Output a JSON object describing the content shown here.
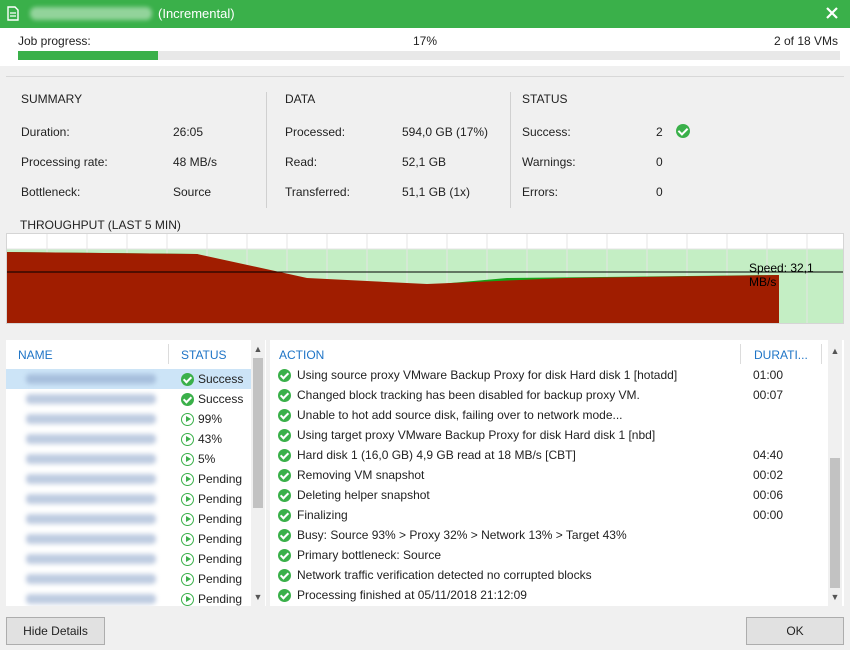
{
  "window": {
    "title": "(Incremental)",
    "close_label": "✕"
  },
  "progress": {
    "label": "Job progress:",
    "percent_text": "17%",
    "percent_value": 0.17,
    "vms_text": "2 of 18 VMs"
  },
  "summary": {
    "heading": "SUMMARY",
    "rows": [
      {
        "key": "Duration:",
        "value": "26:05"
      },
      {
        "key": "Processing rate:",
        "value": "48 MB/s"
      },
      {
        "key": "Bottleneck:",
        "value": "Source"
      }
    ]
  },
  "data": {
    "heading": "DATA",
    "rows": [
      {
        "key": "Processed:",
        "value": "594,0 GB (17%)"
      },
      {
        "key": "Read:",
        "value": "52,1 GB"
      },
      {
        "key": "Transferred:",
        "value": "51,1 GB (1x)"
      }
    ]
  },
  "status": {
    "heading": "STATUS",
    "rows": [
      {
        "key": "Success:",
        "value": "2"
      },
      {
        "key": "Warnings:",
        "value": "0"
      },
      {
        "key": "Errors:",
        "value": "0"
      }
    ]
  },
  "throughput": {
    "label": "THROUGHPUT (LAST 5 MIN)",
    "speed_label": "Speed: 32,1 MB/s"
  },
  "vm_list": {
    "name_header": "NAME",
    "status_header": "STATUS",
    "items": [
      {
        "status": "Success",
        "kind": "ok"
      },
      {
        "status": "Success",
        "kind": "ok"
      },
      {
        "status": "99%",
        "kind": "play"
      },
      {
        "status": "43%",
        "kind": "play"
      },
      {
        "status": "5%",
        "kind": "play"
      },
      {
        "status": "Pending",
        "kind": "play"
      },
      {
        "status": "Pending",
        "kind": "play"
      },
      {
        "status": "Pending",
        "kind": "play"
      },
      {
        "status": "Pending",
        "kind": "play"
      },
      {
        "status": "Pending",
        "kind": "play"
      },
      {
        "status": "Pending",
        "kind": "play"
      },
      {
        "status": "Pending",
        "kind": "play"
      }
    ]
  },
  "actions": {
    "action_header": "ACTION",
    "duration_header": "DURATI...",
    "items": [
      {
        "text": "Using source proxy VMware Backup Proxy for disk Hard disk 1 [hotadd]",
        "duration": "01:00"
      },
      {
        "text": "Changed block tracking has been disabled for backup proxy VM.",
        "duration": "00:07"
      },
      {
        "text": "Unable to hot add source disk, failing over to network mode...",
        "duration": ""
      },
      {
        "text": "Using target proxy VMware Backup Proxy for disk Hard disk 1 [nbd]",
        "duration": ""
      },
      {
        "text": "Hard disk 1 (16,0 GB) 4,9 GB read at 18 MB/s [CBT]",
        "duration": "04:40"
      },
      {
        "text": "Removing VM snapshot",
        "duration": "00:02"
      },
      {
        "text": "Deleting helper snapshot",
        "duration": "00:06"
      },
      {
        "text": "Finalizing",
        "duration": "00:00"
      },
      {
        "text": "Busy: Source 93% > Proxy 32% > Network 13% > Target 43%",
        "duration": ""
      },
      {
        "text": "Primary bottleneck: Source",
        "duration": ""
      },
      {
        "text": "Network traffic verification detected no corrupted blocks",
        "duration": ""
      },
      {
        "text": "Processing finished at 05/11/2018 21:12:09",
        "duration": ""
      }
    ]
  },
  "footer": {
    "hide_details_label": "Hide Details",
    "ok_label": "OK"
  },
  "colors": {
    "accent_green": "#3ab04a",
    "chart_red": "#a01d00",
    "chart_green": "#16a318",
    "chart_light_green": "#c4eec4",
    "header_blue": "#1e74c6"
  }
}
